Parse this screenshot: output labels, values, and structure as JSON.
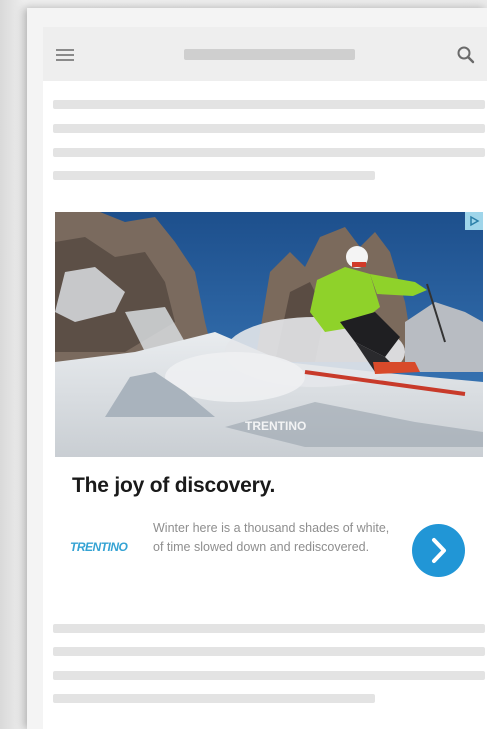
{
  "ad": {
    "headline": "The joy of discovery.",
    "description": "Winter here is a thousand shades of white, of time slowed down and rediscovered.",
    "advertiser_logo_text": "TRENTINO",
    "image_watermark": "TRENTINO",
    "badge_icon": "ad-choices-icon",
    "cta_icon": "chevron-right-icon",
    "cta_color": "#2196d6"
  },
  "appbar": {
    "menu_icon": "hamburger-menu-icon",
    "search_icon": "search-icon"
  }
}
